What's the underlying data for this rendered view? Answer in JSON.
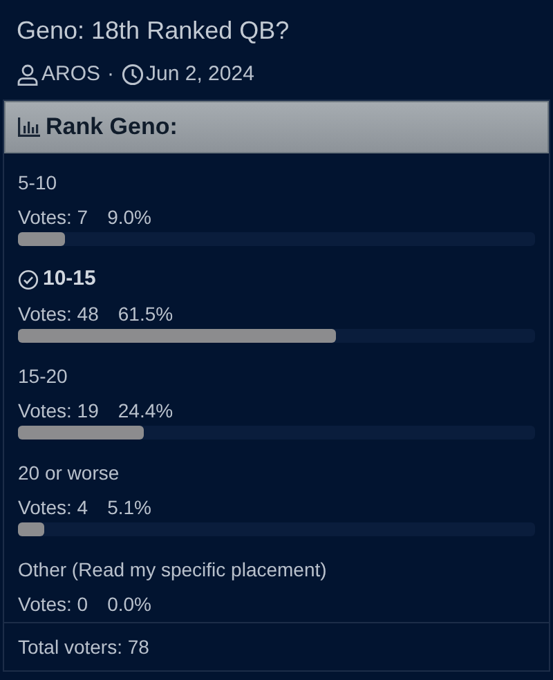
{
  "thread": {
    "title": "Geno: 18th Ranked QB?",
    "author": "AROS",
    "separator": "·",
    "date": "Jun 2, 2024"
  },
  "poll": {
    "question": "Rank Geno:",
    "options": [
      {
        "label": "5-10",
        "votes_label": "Votes: 7",
        "percent": "9.0%",
        "level": 0.09,
        "voted": false
      },
      {
        "label": "10-15",
        "votes_label": "Votes: 48",
        "percent": "61.5%",
        "level": 0.615,
        "voted": true
      },
      {
        "label": "15-20",
        "votes_label": "Votes: 19",
        "percent": "24.4%",
        "level": 0.244,
        "voted": false
      },
      {
        "label": "20 or worse",
        "votes_label": "Votes: 4",
        "percent": "5.1%",
        "level": 0.051,
        "voted": false
      },
      {
        "label": "Other (Read my specific placement)",
        "votes_label": "Votes: 0",
        "percent": "0.0%",
        "voted": false
      }
    ],
    "total": "Total voters: 78"
  }
}
